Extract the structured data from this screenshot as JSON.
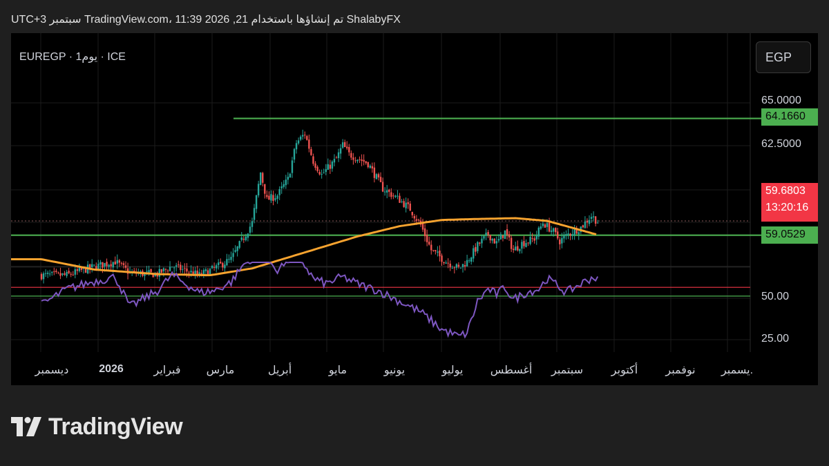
{
  "header": {
    "caption": "ShalabyFX تم إنشاؤها باستخدام TradingView.com، 11:39 2026 ,21 سبتمبر UTC+3"
  },
  "chart_header": {
    "symbol_line": "EUREGP · 1يوم · ICE",
    "currency_button": "EGP"
  },
  "price_axis": {
    "ticks": [
      "65.0000",
      "62.5000"
    ],
    "tags": {
      "high_line": "64.1660",
      "current_price": "59.6803",
      "countdown": "13:20:16",
      "low_line": "59.0529"
    }
  },
  "rsi_axis": {
    "ticks": [
      "50.00",
      "25.00"
    ]
  },
  "time_axis": [
    {
      "label": "ديسمبر",
      "bold": false
    },
    {
      "label": "2026",
      "bold": true
    },
    {
      "label": "فبراير",
      "bold": false
    },
    {
      "label": "مارس",
      "bold": false
    },
    {
      "label": "أبريل",
      "bold": false
    },
    {
      "label": "مايو",
      "bold": false
    },
    {
      "label": "يونيو",
      "bold": false
    },
    {
      "label": "يوليو",
      "bold": false
    },
    {
      "label": "أغسطس",
      "bold": false
    },
    {
      "label": "سبتمبر",
      "bold": false
    },
    {
      "label": "أكتوبر",
      "bold": false
    },
    {
      "label": "نوفمبر",
      "bold": false
    },
    {
      "label": "يسمبر.",
      "bold": false
    }
  ],
  "footer": {
    "brand": "TradingView"
  },
  "colors": {
    "up": "#26a69a",
    "down": "#ef5350",
    "ma": "#f7a32f",
    "rsi": "#7e57c2",
    "level": "#4caf50",
    "rsi_upper": "#f23645",
    "rsi_lower": "#4caf50"
  },
  "chart_data": {
    "type": "candlestick",
    "symbol": "EUREGP",
    "interval": "1D",
    "currency": "EGP",
    "price_range": [
      57.2,
      65.0
    ],
    "horizontal_levels": [
      64.166,
      59.0529
    ],
    "current_price": 59.6803,
    "price_anchors": [
      {
        "t": 0,
        "p": 57.3
      },
      {
        "t": 12,
        "p": 57.3
      },
      {
        "t": 24,
        "p": 57.65
      },
      {
        "t": 35,
        "p": 57.9
      },
      {
        "t": 42,
        "p": 57.4
      },
      {
        "t": 55,
        "p": 57.35
      },
      {
        "t": 62,
        "p": 57.7
      },
      {
        "t": 75,
        "p": 57.3
      },
      {
        "t": 82,
        "p": 57.6
      },
      {
        "t": 90,
        "p": 58.0
      },
      {
        "t": 95,
        "p": 58.8
      },
      {
        "t": 100,
        "p": 59.6
      },
      {
        "t": 104,
        "p": 61.8
      },
      {
        "t": 107,
        "p": 60.6
      },
      {
        "t": 112,
        "p": 60.8
      },
      {
        "t": 117,
        "p": 61.5
      },
      {
        "t": 121,
        "p": 63.1
      },
      {
        "t": 125,
        "p": 63.5
      },
      {
        "t": 129,
        "p": 62.3
      },
      {
        "t": 133,
        "p": 61.7
      },
      {
        "t": 140,
        "p": 62.4
      },
      {
        "t": 143,
        "p": 63.0
      },
      {
        "t": 146,
        "p": 62.6
      },
      {
        "t": 155,
        "p": 62.2
      },
      {
        "t": 162,
        "p": 61.1
      },
      {
        "t": 170,
        "p": 60.6
      },
      {
        "t": 175,
        "p": 60.2
      },
      {
        "t": 180,
        "p": 59.5
      },
      {
        "t": 185,
        "p": 58.4
      },
      {
        "t": 192,
        "p": 57.9
      },
      {
        "t": 198,
        "p": 57.6
      },
      {
        "t": 202,
        "p": 57.9
      },
      {
        "t": 207,
        "p": 58.6
      },
      {
        "t": 212,
        "p": 59.1
      },
      {
        "t": 216,
        "p": 58.7
      },
      {
        "t": 220,
        "p": 59.2
      },
      {
        "t": 224,
        "p": 58.4
      },
      {
        "t": 228,
        "p": 58.7
      },
      {
        "t": 234,
        "p": 58.9
      },
      {
        "t": 238,
        "p": 59.6
      },
      {
        "t": 243,
        "p": 59.2
      },
      {
        "t": 246,
        "p": 58.8
      },
      {
        "t": 250,
        "p": 59.1
      },
      {
        "t": 256,
        "p": 59.4
      },
      {
        "t": 261,
        "p": 59.9
      },
      {
        "t": 264,
        "p": 59.65
      }
    ],
    "moving_average_anchors": [
      {
        "t": 0,
        "p": 58.0
      },
      {
        "t": 25,
        "p": 57.55
      },
      {
        "t": 55,
        "p": 57.35
      },
      {
        "t": 80,
        "p": 57.3
      },
      {
        "t": 100,
        "p": 57.6
      },
      {
        "t": 125,
        "p": 58.3
      },
      {
        "t": 150,
        "p": 59.0
      },
      {
        "t": 170,
        "p": 59.45
      },
      {
        "t": 190,
        "p": 59.72
      },
      {
        "t": 205,
        "p": 59.76
      },
      {
        "t": 225,
        "p": 59.8
      },
      {
        "t": 240,
        "p": 59.68
      },
      {
        "t": 255,
        "p": 59.3
      },
      {
        "t": 264,
        "p": 59.07
      }
    ],
    "rsi": {
      "range": [
        15,
        70
      ],
      "levels": [
        55,
        50
      ],
      "anchors": [
        {
          "t": 0,
          "p": 45
        },
        {
          "t": 12,
          "p": 54
        },
        {
          "t": 24,
          "p": 58
        },
        {
          "t": 35,
          "p": 61
        },
        {
          "t": 42,
          "p": 44
        },
        {
          "t": 55,
          "p": 53
        },
        {
          "t": 62,
          "p": 62
        },
        {
          "t": 75,
          "p": 52
        },
        {
          "t": 82,
          "p": 53
        },
        {
          "t": 90,
          "p": 58
        },
        {
          "t": 96,
          "p": 68
        },
        {
          "t": 104,
          "p": 76
        },
        {
          "t": 112,
          "p": 65
        },
        {
          "t": 121,
          "p": 75
        },
        {
          "t": 129,
          "p": 60
        },
        {
          "t": 135,
          "p": 57
        },
        {
          "t": 143,
          "p": 61
        },
        {
          "t": 150,
          "p": 57
        },
        {
          "t": 160,
          "p": 53
        },
        {
          "t": 170,
          "p": 47
        },
        {
          "t": 180,
          "p": 41
        },
        {
          "t": 190,
          "p": 31
        },
        {
          "t": 198,
          "p": 27
        },
        {
          "t": 202,
          "p": 29
        },
        {
          "t": 207,
          "p": 47
        },
        {
          "t": 212,
          "p": 54
        },
        {
          "t": 216,
          "p": 51
        },
        {
          "t": 220,
          "p": 55
        },
        {
          "t": 224,
          "p": 48
        },
        {
          "t": 230,
          "p": 52
        },
        {
          "t": 236,
          "p": 54
        },
        {
          "t": 240,
          "p": 60
        },
        {
          "t": 245,
          "p": 56
        },
        {
          "t": 249,
          "p": 52
        },
        {
          "t": 256,
          "p": 57
        },
        {
          "t": 262,
          "p": 61
        },
        {
          "t": 264,
          "p": 59
        }
      ]
    }
  }
}
